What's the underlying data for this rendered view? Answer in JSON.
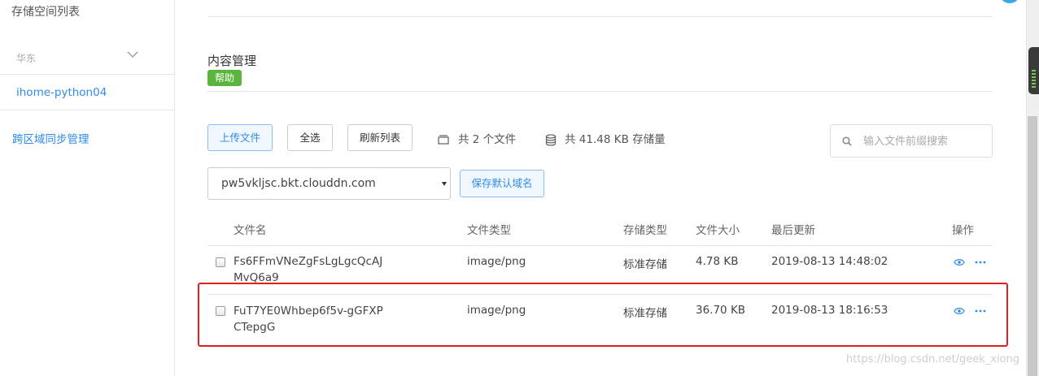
{
  "sidebar": {
    "top_title": "存储空间列表",
    "region": "华东",
    "bucket": "ihome-python04",
    "sync_link": "跨区域同步管理"
  },
  "main": {
    "title": "内容管理",
    "help_badge": "帮助",
    "toolbar": {
      "upload": "上传文件",
      "select_all": "全选",
      "refresh": "刷新列表"
    },
    "stats": {
      "files": "共 2 个文件",
      "storage": "共 41.48 KB 存储量"
    },
    "search": {
      "placeholder": "输入文件前缀搜索"
    },
    "domain": {
      "selected": "pw5vkljsc.bkt.clouddn.com",
      "save_button": "保存默认域名"
    }
  },
  "table": {
    "columns": {
      "name": "文件名",
      "type": "文件类型",
      "storage_type": "存储类型",
      "size": "文件大小",
      "updated": "最后更新",
      "actions": "操作"
    },
    "rows": [
      {
        "name": "Fs6FFmVNeZgFsLgLgcQcAJMvQ6a9",
        "type": "image/png",
        "storage_type": "标准存储",
        "size": "4.78 KB",
        "updated": "2019-08-13 14:48:02"
      },
      {
        "name": "FuT7YE0Whbep6f5v-gGFXPCTepgG",
        "type": "image/png",
        "storage_type": "标准存储",
        "size": "36.70 KB",
        "updated": "2019-08-13 18:16:53"
      }
    ]
  },
  "icons": {
    "region_toggle": "chevron-down-icon",
    "file_count": "file-icon",
    "storage": "database-icon",
    "search": "search-icon",
    "preview": "eye-icon",
    "more": "more-icon"
  },
  "colors": {
    "link_blue": "#2d8ce8",
    "help_green": "#5ab53c",
    "highlight_red": "#e02020"
  },
  "watermark": "https://blog.csdn.net/geek_xiong"
}
